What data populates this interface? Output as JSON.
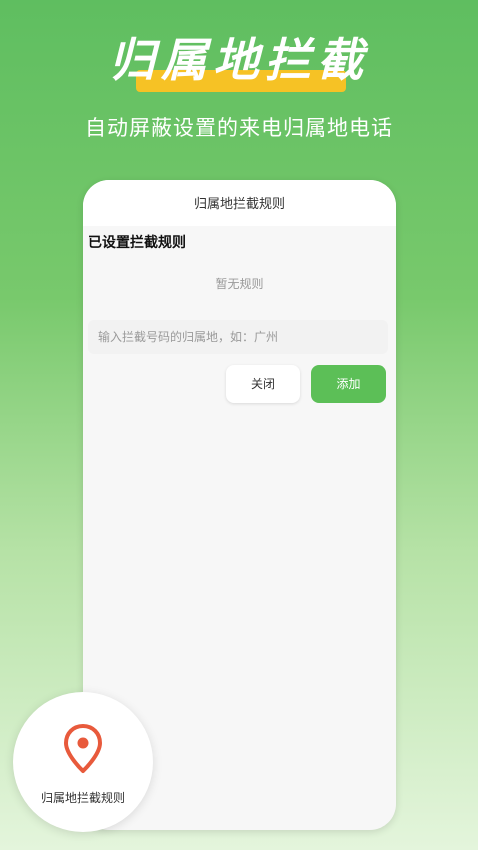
{
  "hero": {
    "title": "归属地拦截",
    "subtitle": "自动屏蔽设置的来电归属地电话"
  },
  "phone": {
    "header_title": "归属地拦截规则",
    "section_title": "已设置拦截规则",
    "empty_text": "暂无规则",
    "input_placeholder": "输入拦截号码的归属地，如：广州",
    "input_value": "",
    "close_label": "关闭",
    "add_label": "添加"
  },
  "badge": {
    "icon": "location-pin-icon",
    "label": "归属地拦截规则"
  },
  "colors": {
    "accent_green": "#5cbf57",
    "highlight_yellow": "#f6c225",
    "pin_red": "#e85a3c"
  }
}
